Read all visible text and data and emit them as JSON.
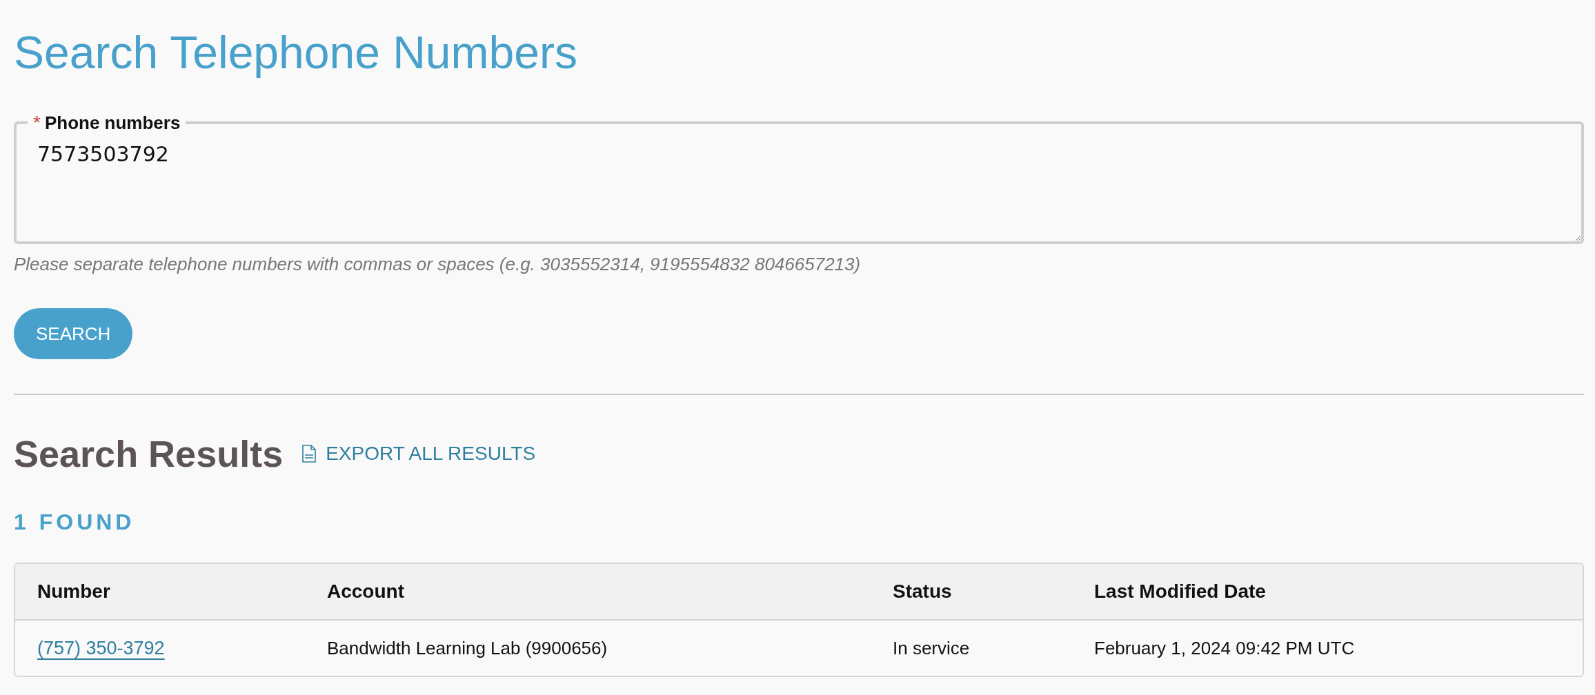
{
  "page": {
    "title": "Search Telephone Numbers"
  },
  "form": {
    "field": {
      "label": "Phone numbers",
      "required_mark": "*",
      "value": "7573503792",
      "help": "Please separate telephone numbers with commas or spaces (e.g. 3035552314, 9195554832 8046657213)"
    },
    "submit": "SEARCH"
  },
  "results": {
    "title": "Search Results",
    "export": "EXPORT ALL RESULTS",
    "count": "1 FOUND",
    "columns": [
      "Number",
      "Account",
      "Status",
      "Last Modified Date"
    ],
    "rows": [
      {
        "number": "(757) 350-3792",
        "account": "Bandwidth Learning Lab (9900656)",
        "status": "In service",
        "last_modified": "February 1, 2024 09:42 PM UTC"
      }
    ]
  }
}
